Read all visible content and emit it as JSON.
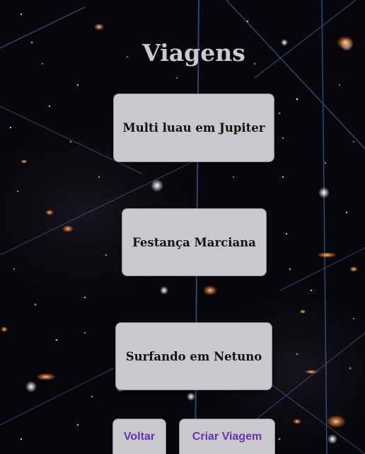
{
  "page": {
    "title": "Viagens"
  },
  "trips": [
    {
      "label": "Multi luau em Jupiter"
    },
    {
      "label": "Festança Marciana"
    },
    {
      "label": "Surfando em Netuno"
    }
  ],
  "actions": {
    "back_label": "Voltar",
    "create_label": "Criar Viagem"
  },
  "colors": {
    "background": "#07070b",
    "card": "#c9c9cd",
    "title": "#c9c9cf",
    "button_text": "#6a31b3"
  }
}
